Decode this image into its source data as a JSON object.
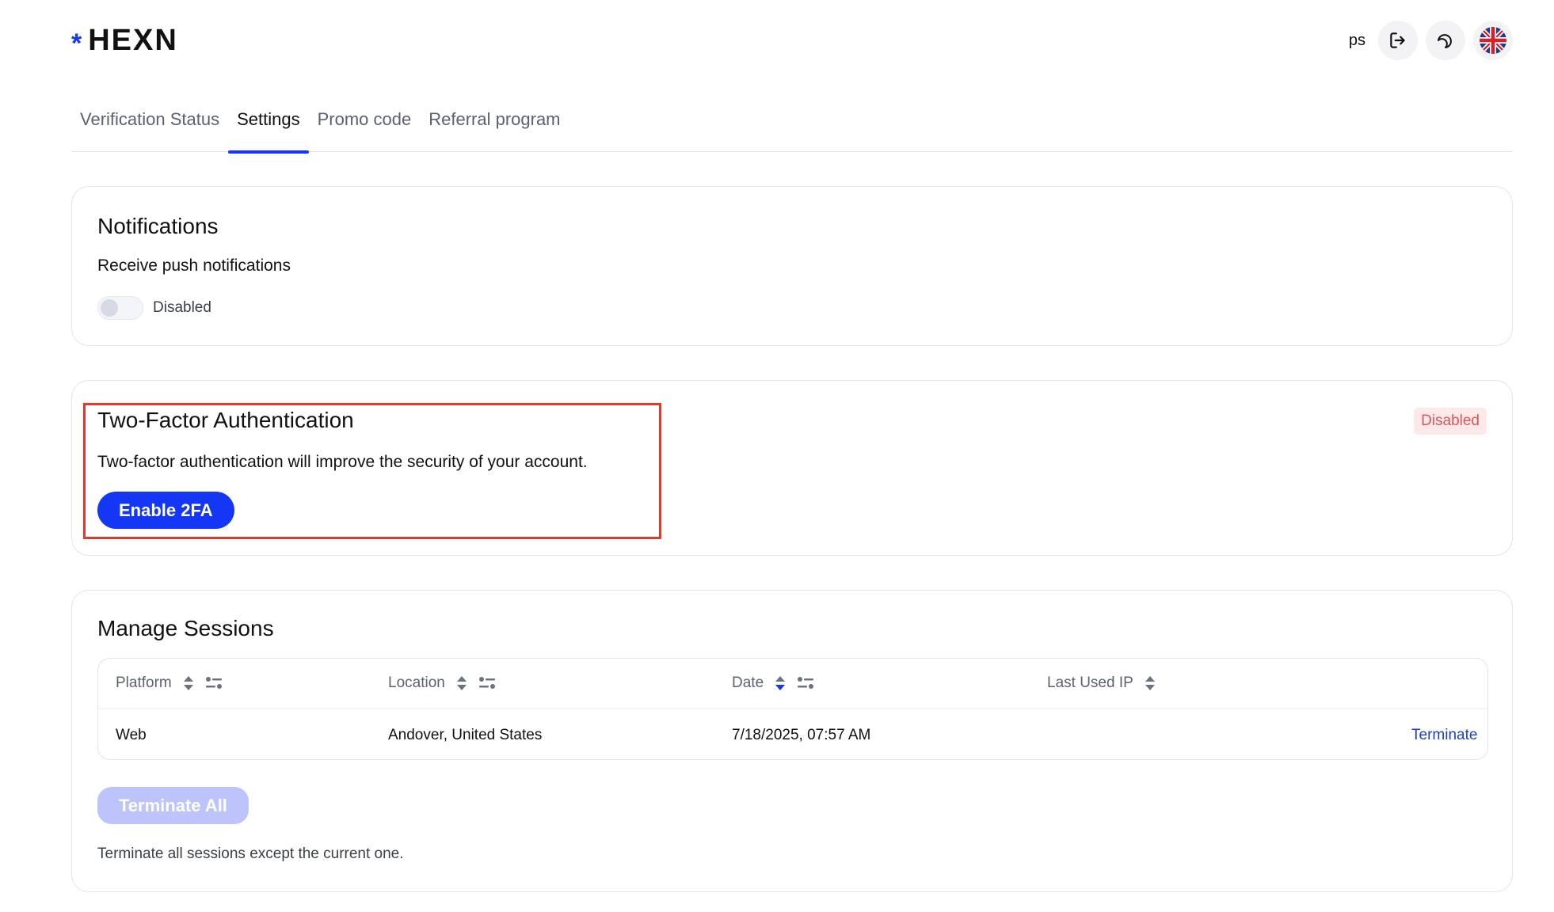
{
  "header": {
    "logo_star": "*",
    "logo_text": "HEXN",
    "user_initials": "ps",
    "icons": [
      "logout-icon",
      "moon-icon",
      "uk-flag-icon"
    ]
  },
  "tabs": [
    {
      "label": "Verification Status",
      "active": false
    },
    {
      "label": "Settings",
      "active": true
    },
    {
      "label": "Promo code",
      "active": false
    },
    {
      "label": "Referral program",
      "active": false
    }
  ],
  "notifications": {
    "title": "Notifications",
    "subtitle": "Receive push notifications",
    "toggle_label": "Disabled",
    "enabled": false
  },
  "two_factor": {
    "title": "Two-Factor Authentication",
    "description": "Two-factor authentication will improve the security of your account.",
    "button_label": "Enable 2FA",
    "status": "Disabled"
  },
  "sessions": {
    "title": "Manage Sessions",
    "columns": [
      "Platform",
      "Location",
      "Date",
      "Last Used IP"
    ],
    "rows": [
      {
        "platform": "Web",
        "location": "Andover, United States",
        "date": "7/18/2025, 07:57 AM",
        "ip": "",
        "action": "Terminate"
      }
    ],
    "terminate_all_label": "Terminate All",
    "note": "Terminate all sessions except the current one."
  },
  "colors": {
    "accent": "#1437f5",
    "highlight_border": "#e23a2a",
    "badge_bg": "#fde9ea",
    "badge_text": "#e2545a",
    "disabled_button": "#bcc4fb",
    "link": "#1f3fc4"
  }
}
